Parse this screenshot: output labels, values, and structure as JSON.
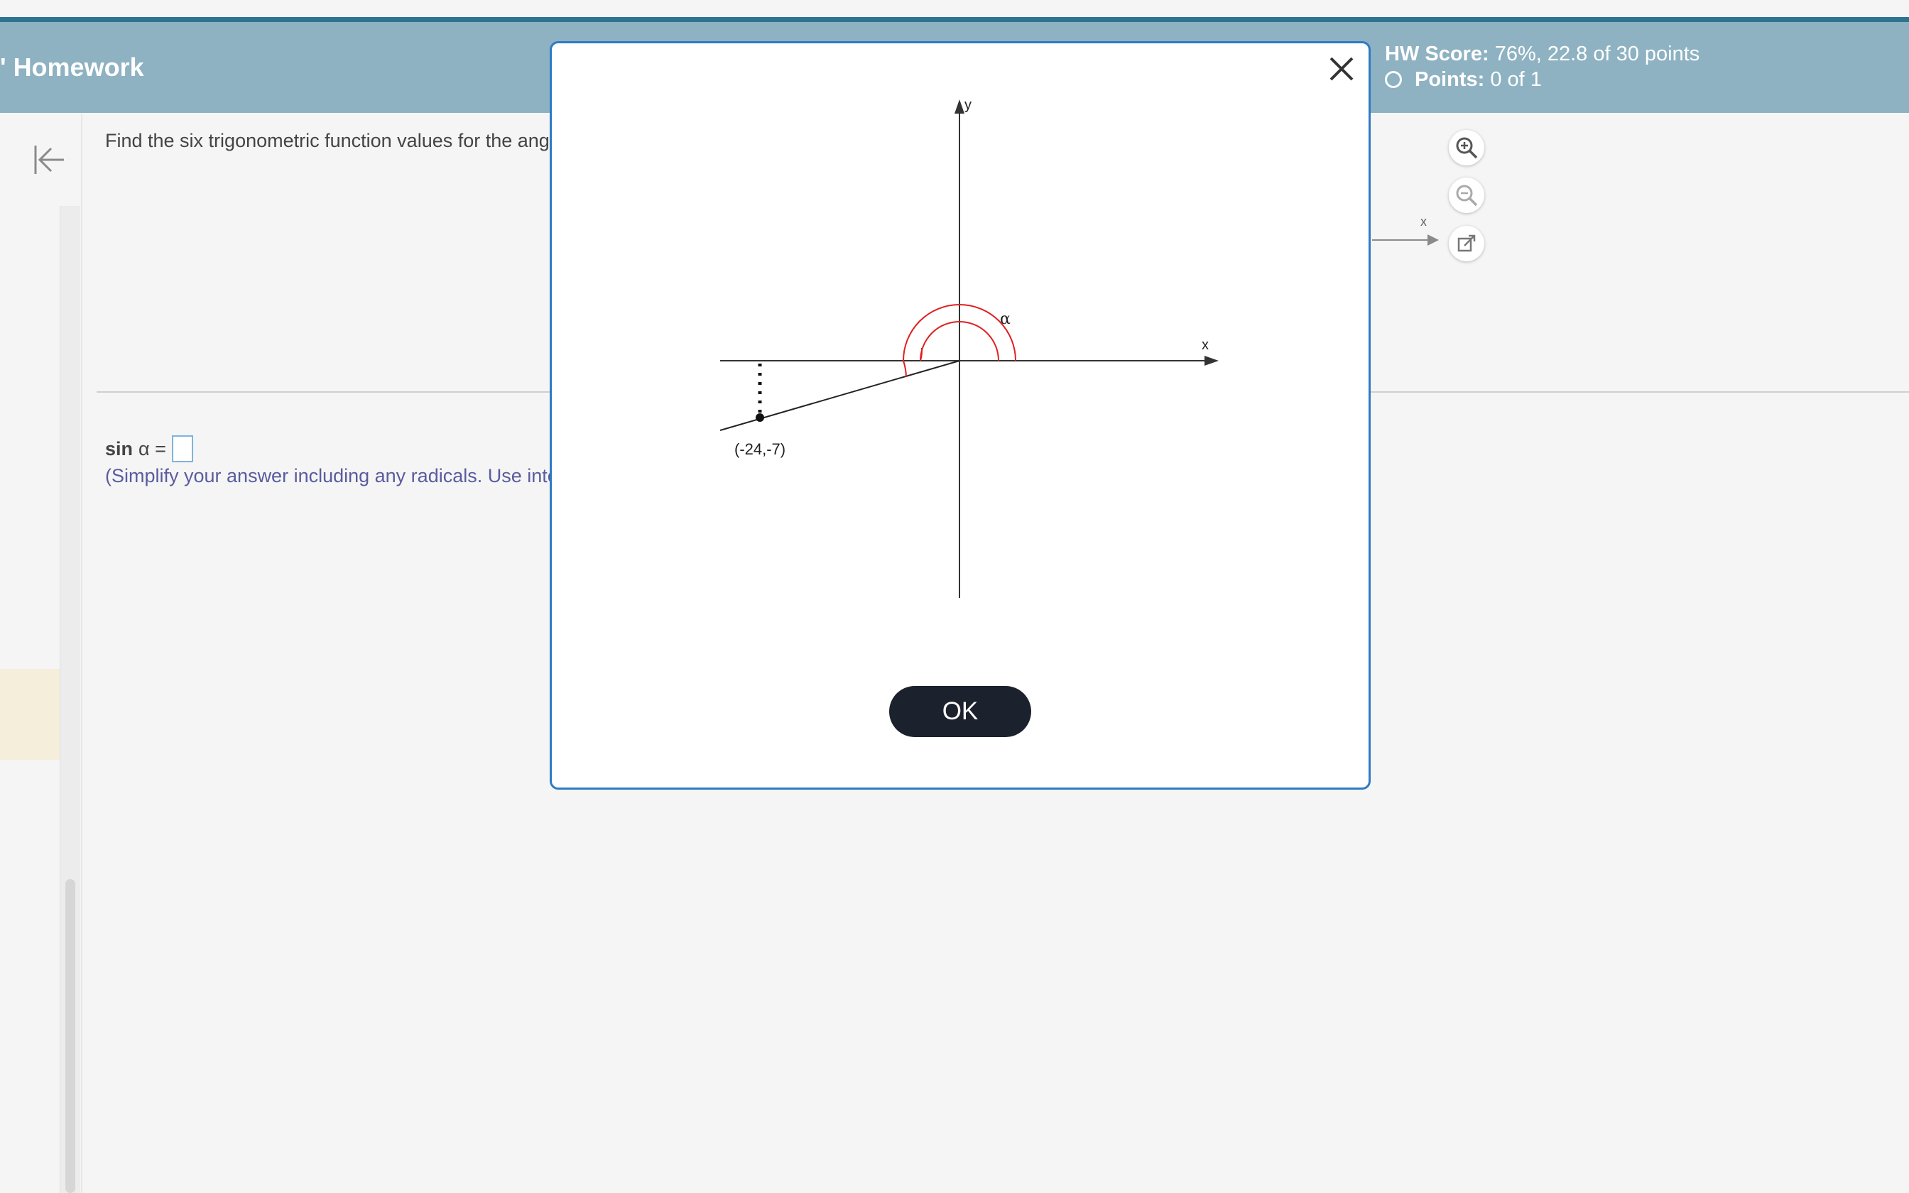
{
  "header": {
    "title": "' Homework",
    "hw_score_label": "HW Score:",
    "hw_score_value": "76%, 22.8 of 30 points",
    "points_label": "Points:",
    "points_value": "0 of 1"
  },
  "question": {
    "text": "Find the six trigonometric function values for the angle",
    "answer_label_func": "sin",
    "answer_label_var": "α =",
    "hint": "(Simplify your answer including any radicals. Use integ"
  },
  "background_figure": {
    "x_label": "x"
  },
  "modal": {
    "diagram": {
      "y_label": "y",
      "x_label": "x",
      "angle_label": "α",
      "point_label": "(-24,-7)"
    },
    "ok_label": "OK"
  },
  "colors": {
    "header_bg": "#8eb2c2",
    "top_strip": "#2e7491",
    "modal_border": "#2d7ac6",
    "angle_arc": "#e02020",
    "ok_button": "#1c222d",
    "hint_text": "#5a5c9e"
  },
  "icons": {
    "collapse": "collapse-left-icon",
    "close": "close-icon",
    "zoom_in": "zoom-in-icon",
    "zoom_out": "zoom-out-icon",
    "popout": "open-external-icon",
    "points_status": "circle-outline-icon"
  }
}
